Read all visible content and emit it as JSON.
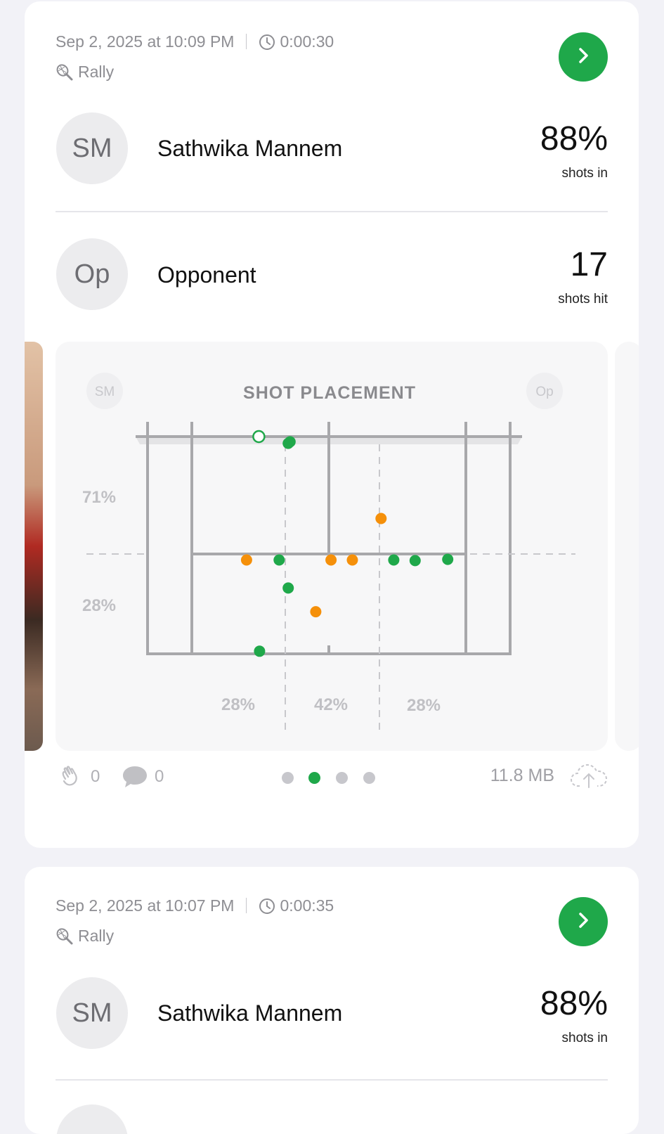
{
  "sessions": [
    {
      "datetime": "Sep 2, 2025 at 10:09 PM",
      "duration": "0:00:30",
      "type": "Rally",
      "player": {
        "initials": "SM",
        "name": "Sathwika Mannem",
        "stat_value": "88%",
        "stat_label": "shots in"
      },
      "opponent": {
        "initials": "Op",
        "name": "Opponent",
        "stat_value": "17",
        "stat_label": "shots hit"
      },
      "likes": "0",
      "comments": "0",
      "file_size": "11.8 MB",
      "carousel": {
        "pages": 4,
        "active_page": 2
      }
    },
    {
      "datetime": "Sep 2, 2025 at 10:07 PM",
      "duration": "0:00:35",
      "type": "Rally",
      "player": {
        "initials": "SM",
        "name": "Sathwika Mannem",
        "stat_value": "88%",
        "stat_label": "shots in"
      }
    }
  ],
  "chart_data": {
    "type": "scatter",
    "title": "SHOT PLACEMENT",
    "left_badge": "SM",
    "right_badge": "Op",
    "depth_labels": [
      "71%",
      "28%"
    ],
    "width_labels": [
      "28%",
      "42%",
      "28%"
    ],
    "colors": {
      "in": "#1fa84a",
      "out": "#f5900a",
      "court": "#a8a8ab",
      "label": "#c0c0c4"
    },
    "court": {
      "x_range": [
        0,
        100
      ],
      "y_range": [
        0,
        100
      ],
      "note": "x: left-to-right across court, y: baseline(0) to net(100)"
    },
    "points": [
      {
        "x": 30.7,
        "y": 100,
        "category": "in",
        "hollow": true
      },
      {
        "x": 39.3,
        "y": 97.6,
        "category": "in"
      },
      {
        "x": 38.8,
        "y": 96.9,
        "category": "in"
      },
      {
        "x": 64.4,
        "y": 62.3,
        "category": "out"
      },
      {
        "x": 27.3,
        "y": 43.2,
        "category": "out"
      },
      {
        "x": 36.3,
        "y": 43.2,
        "category": "in"
      },
      {
        "x": 50.6,
        "y": 43.2,
        "category": "out"
      },
      {
        "x": 56.5,
        "y": 43.2,
        "category": "out"
      },
      {
        "x": 67.9,
        "y": 43.2,
        "category": "in"
      },
      {
        "x": 73.8,
        "y": 42.9,
        "category": "in"
      },
      {
        "x": 82.8,
        "y": 43.5,
        "category": "in"
      },
      {
        "x": 38.8,
        "y": 30.3,
        "category": "in"
      },
      {
        "x": 46.4,
        "y": 19.4,
        "category": "out"
      },
      {
        "x": 30.9,
        "y": 1.2,
        "category": "in"
      }
    ]
  }
}
